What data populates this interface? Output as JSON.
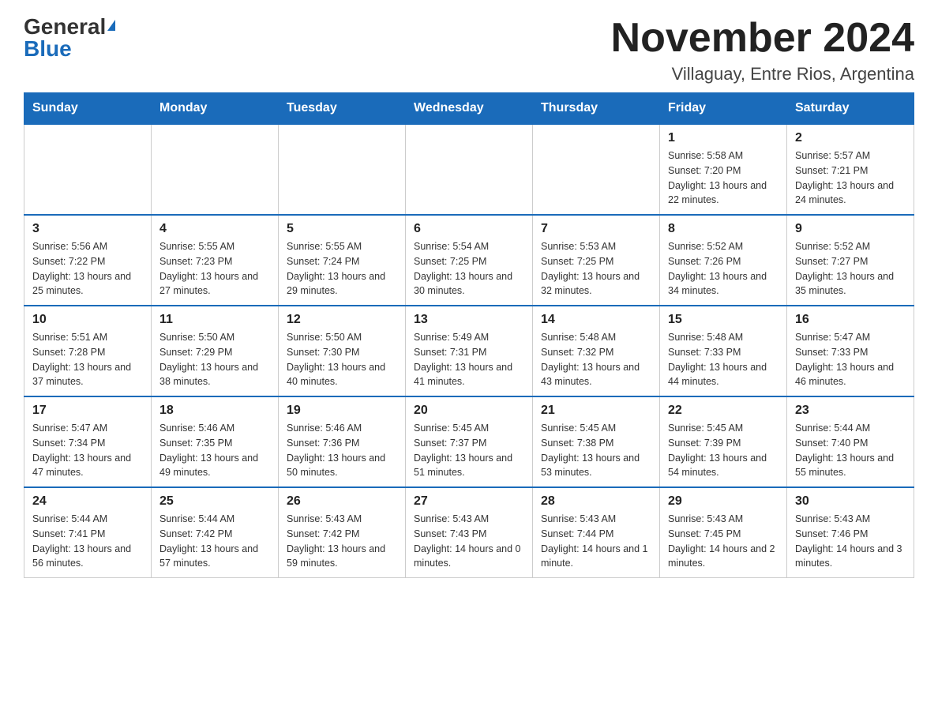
{
  "logo": {
    "general": "General",
    "blue": "Blue"
  },
  "header": {
    "month": "November 2024",
    "location": "Villaguay, Entre Rios, Argentina"
  },
  "days_of_week": [
    "Sunday",
    "Monday",
    "Tuesday",
    "Wednesday",
    "Thursday",
    "Friday",
    "Saturday"
  ],
  "weeks": [
    [
      {
        "day": "",
        "info": ""
      },
      {
        "day": "",
        "info": ""
      },
      {
        "day": "",
        "info": ""
      },
      {
        "day": "",
        "info": ""
      },
      {
        "day": "",
        "info": ""
      },
      {
        "day": "1",
        "info": "Sunrise: 5:58 AM\nSunset: 7:20 PM\nDaylight: 13 hours and 22 minutes."
      },
      {
        "day": "2",
        "info": "Sunrise: 5:57 AM\nSunset: 7:21 PM\nDaylight: 13 hours and 24 minutes."
      }
    ],
    [
      {
        "day": "3",
        "info": "Sunrise: 5:56 AM\nSunset: 7:22 PM\nDaylight: 13 hours and 25 minutes."
      },
      {
        "day": "4",
        "info": "Sunrise: 5:55 AM\nSunset: 7:23 PM\nDaylight: 13 hours and 27 minutes."
      },
      {
        "day": "5",
        "info": "Sunrise: 5:55 AM\nSunset: 7:24 PM\nDaylight: 13 hours and 29 minutes."
      },
      {
        "day": "6",
        "info": "Sunrise: 5:54 AM\nSunset: 7:25 PM\nDaylight: 13 hours and 30 minutes."
      },
      {
        "day": "7",
        "info": "Sunrise: 5:53 AM\nSunset: 7:25 PM\nDaylight: 13 hours and 32 minutes."
      },
      {
        "day": "8",
        "info": "Sunrise: 5:52 AM\nSunset: 7:26 PM\nDaylight: 13 hours and 34 minutes."
      },
      {
        "day": "9",
        "info": "Sunrise: 5:52 AM\nSunset: 7:27 PM\nDaylight: 13 hours and 35 minutes."
      }
    ],
    [
      {
        "day": "10",
        "info": "Sunrise: 5:51 AM\nSunset: 7:28 PM\nDaylight: 13 hours and 37 minutes."
      },
      {
        "day": "11",
        "info": "Sunrise: 5:50 AM\nSunset: 7:29 PM\nDaylight: 13 hours and 38 minutes."
      },
      {
        "day": "12",
        "info": "Sunrise: 5:50 AM\nSunset: 7:30 PM\nDaylight: 13 hours and 40 minutes."
      },
      {
        "day": "13",
        "info": "Sunrise: 5:49 AM\nSunset: 7:31 PM\nDaylight: 13 hours and 41 minutes."
      },
      {
        "day": "14",
        "info": "Sunrise: 5:48 AM\nSunset: 7:32 PM\nDaylight: 13 hours and 43 minutes."
      },
      {
        "day": "15",
        "info": "Sunrise: 5:48 AM\nSunset: 7:33 PM\nDaylight: 13 hours and 44 minutes."
      },
      {
        "day": "16",
        "info": "Sunrise: 5:47 AM\nSunset: 7:33 PM\nDaylight: 13 hours and 46 minutes."
      }
    ],
    [
      {
        "day": "17",
        "info": "Sunrise: 5:47 AM\nSunset: 7:34 PM\nDaylight: 13 hours and 47 minutes."
      },
      {
        "day": "18",
        "info": "Sunrise: 5:46 AM\nSunset: 7:35 PM\nDaylight: 13 hours and 49 minutes."
      },
      {
        "day": "19",
        "info": "Sunrise: 5:46 AM\nSunset: 7:36 PM\nDaylight: 13 hours and 50 minutes."
      },
      {
        "day": "20",
        "info": "Sunrise: 5:45 AM\nSunset: 7:37 PM\nDaylight: 13 hours and 51 minutes."
      },
      {
        "day": "21",
        "info": "Sunrise: 5:45 AM\nSunset: 7:38 PM\nDaylight: 13 hours and 53 minutes."
      },
      {
        "day": "22",
        "info": "Sunrise: 5:45 AM\nSunset: 7:39 PM\nDaylight: 13 hours and 54 minutes."
      },
      {
        "day": "23",
        "info": "Sunrise: 5:44 AM\nSunset: 7:40 PM\nDaylight: 13 hours and 55 minutes."
      }
    ],
    [
      {
        "day": "24",
        "info": "Sunrise: 5:44 AM\nSunset: 7:41 PM\nDaylight: 13 hours and 56 minutes."
      },
      {
        "day": "25",
        "info": "Sunrise: 5:44 AM\nSunset: 7:42 PM\nDaylight: 13 hours and 57 minutes."
      },
      {
        "day": "26",
        "info": "Sunrise: 5:43 AM\nSunset: 7:42 PM\nDaylight: 13 hours and 59 minutes."
      },
      {
        "day": "27",
        "info": "Sunrise: 5:43 AM\nSunset: 7:43 PM\nDaylight: 14 hours and 0 minutes."
      },
      {
        "day": "28",
        "info": "Sunrise: 5:43 AM\nSunset: 7:44 PM\nDaylight: 14 hours and 1 minute."
      },
      {
        "day": "29",
        "info": "Sunrise: 5:43 AM\nSunset: 7:45 PM\nDaylight: 14 hours and 2 minutes."
      },
      {
        "day": "30",
        "info": "Sunrise: 5:43 AM\nSunset: 7:46 PM\nDaylight: 14 hours and 3 minutes."
      }
    ]
  ]
}
